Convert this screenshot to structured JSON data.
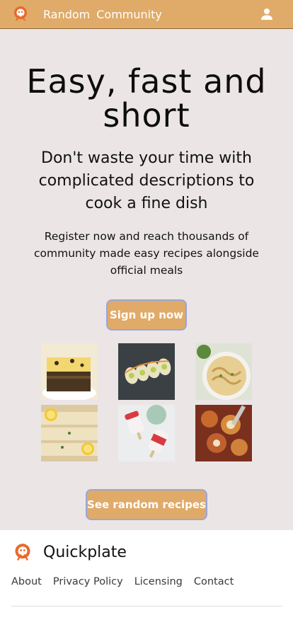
{
  "nav": {
    "logo": "chef-logo-icon",
    "links": [
      "Random",
      "Community"
    ],
    "user_icon": "user-icon"
  },
  "hero": {
    "title": "Easy, fast and short",
    "subtitle": "Don't waste your time with complicated descriptions to cook a fine dish",
    "description": "Register now and reach thousands of community made easy recipes alongside official meals",
    "signup_label": "Sign up now",
    "random_label": "See random recipes",
    "images": [
      "brownie-blondie-bars",
      "sushi-rolls-on-slate",
      "creamy-pasta-bowl",
      "lemon-fish-fillets",
      "strawberry-popsicles",
      "baked-pasta-shells"
    ]
  },
  "footer": {
    "brand": "Quickplate",
    "links": [
      "About",
      "Privacy Policy",
      "Licensing",
      "Contact"
    ]
  },
  "colors": {
    "accent": "#e0aa69",
    "button_border": "#9ba6d8",
    "hero_bg": "#ebe6e5",
    "logo_orange": "#e86a2a"
  }
}
